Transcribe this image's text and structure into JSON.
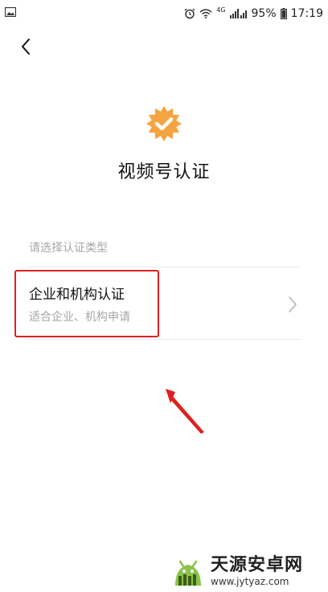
{
  "status_bar": {
    "network": "4G",
    "battery": "95%",
    "time": "17:19",
    "icons": [
      "gallery-notification-icon",
      "alarm-icon",
      "wifi-icon",
      "signal-icon",
      "battery-icon"
    ]
  },
  "header": {
    "back_icon": "back-chevron-icon"
  },
  "verify": {
    "badge_icon": "verified-badge-icon",
    "badge_color": "#f5a442",
    "title": "视频号认证"
  },
  "section": {
    "label": "请选择认证类型"
  },
  "options": [
    {
      "title": "企业和机构认证",
      "subtitle": "适合企业、机构申请",
      "icon": "chevron-right-icon"
    }
  ],
  "annotation": {
    "highlight_color": "#e02020",
    "arrow_icon": "pointer-arrow-icon"
  },
  "watermark": {
    "name": "天源安卓网",
    "url": "www.jytyaz.com"
  }
}
